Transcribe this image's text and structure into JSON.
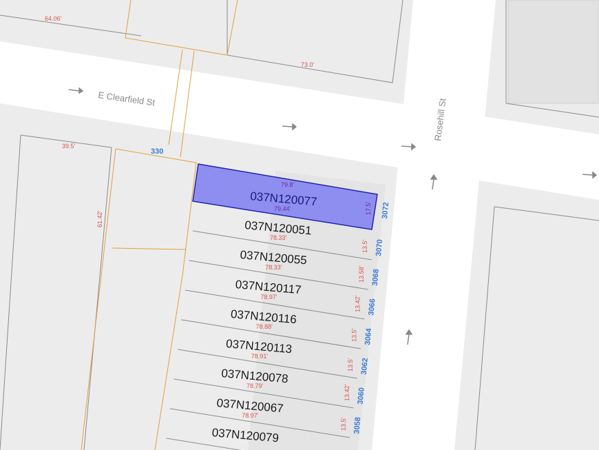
{
  "streets": {
    "clearfield": "E Clearfield St",
    "rosehill": "Rosehill St"
  },
  "dims_top": {
    "a": "64.06'",
    "b": "73.0'"
  },
  "dims_left": {
    "a": "39.5'",
    "b": "61.42'"
  },
  "corner_address": "330",
  "selected_parcel": {
    "id": "037N120077",
    "front": "79.8'",
    "back": "79.44'",
    "width": "17.5'",
    "address": "3072"
  },
  "parcels": [
    {
      "id": "037N120051",
      "depth": "78.33'",
      "width": "13.5'",
      "address": "3070"
    },
    {
      "id": "037N120055",
      "depth": "78.33'",
      "width": "13.58'",
      "address": "3068"
    },
    {
      "id": "037N120117",
      "depth": "78.97'",
      "width": "13.42'",
      "address": "3066"
    },
    {
      "id": "037N120116",
      "depth": "78.88'",
      "width": "13.5'",
      "address": "3064"
    },
    {
      "id": "037N120113",
      "depth": "78.91'",
      "width": "13.5'",
      "address": "3062"
    },
    {
      "id": "037N120078",
      "depth": "78.79'",
      "width": "13.42'",
      "address": "3060"
    },
    {
      "id": "037N120067",
      "depth": "78.97'",
      "width": "13.5'",
      "address": "3058"
    },
    {
      "id": "037N120079",
      "depth": "",
      "width": "",
      "address": ""
    }
  ],
  "colors": {
    "road": "#ffffff",
    "block": "#ececec",
    "building": "#e2e2e2",
    "parcel_line": "#8a8a8a",
    "lot_line": "#e0a040",
    "selected_fill": "#8e8ef0",
    "selected_stroke": "#2222aa",
    "dimension": "#d9534f",
    "address": "#3a7bd5"
  }
}
